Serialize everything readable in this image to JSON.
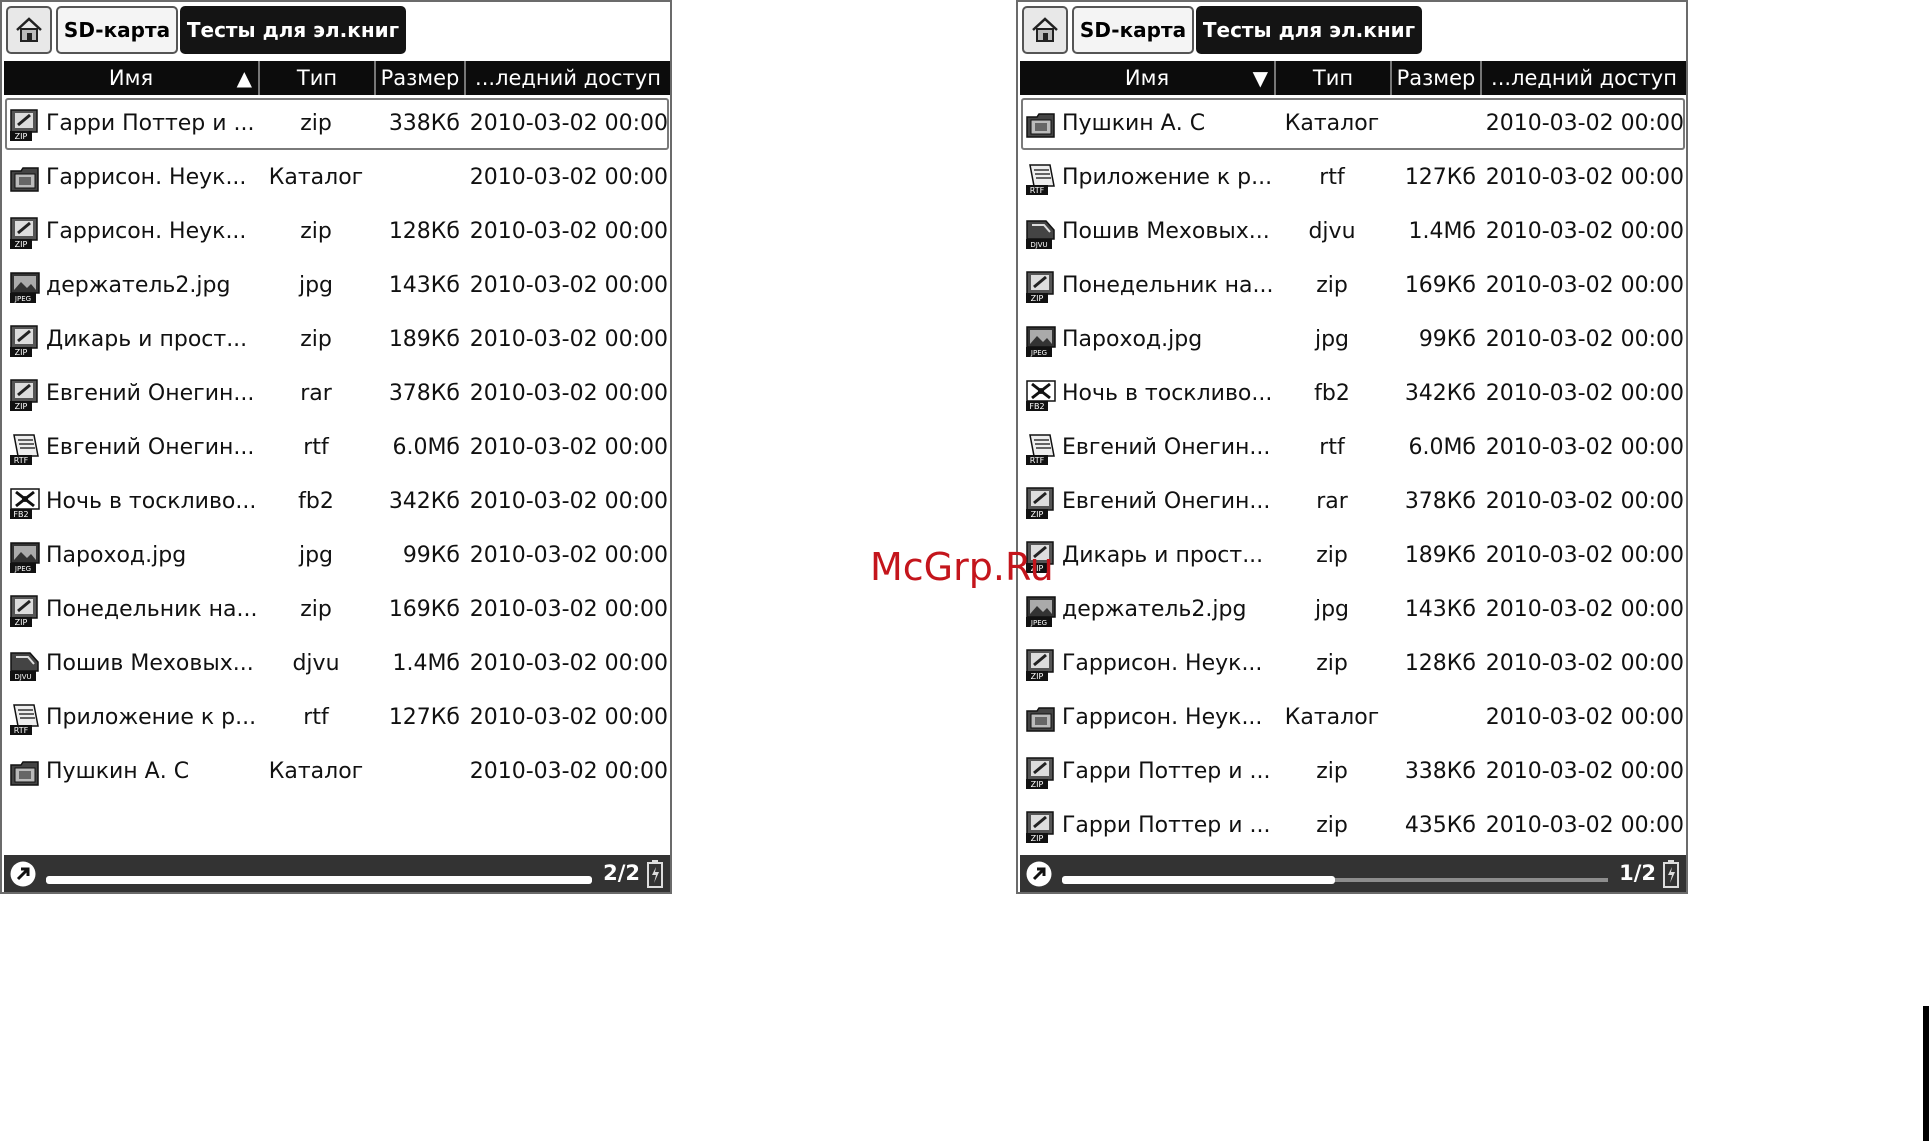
{
  "watermark": "McGrp.Ru",
  "panels": [
    {
      "breadcrumb": {
        "home_icon": "home-icon",
        "sd_label": "SD-карта",
        "current_label": "Тесты для эл.книг"
      },
      "columns": {
        "name": "Имя",
        "type": "Тип",
        "size": "Размер",
        "date": "...ледний доступ",
        "sort_indicator": "▲"
      },
      "rows": [
        {
          "icon": "zip-icon",
          "name": "Гарри Поттер и ...",
          "type": "zip",
          "size": "338Кб",
          "date": "2010-03-02 00:00",
          "selected": true
        },
        {
          "icon": "folder-icon",
          "name": "Гаррисон. Неук...",
          "type": "Каталог",
          "size": "",
          "date": "2010-03-02 00:00"
        },
        {
          "icon": "zip-icon",
          "name": "Гаррисон. Неук...",
          "type": "zip",
          "size": "128Кб",
          "date": "2010-03-02 00:00"
        },
        {
          "icon": "jpeg-icon",
          "name": "держатель2.jpg",
          "type": "jpg",
          "size": "143Кб",
          "date": "2010-03-02 00:00"
        },
        {
          "icon": "zip-icon",
          "name": "Дикарь и прост...",
          "type": "zip",
          "size": "189Кб",
          "date": "2010-03-02 00:00"
        },
        {
          "icon": "zip-icon",
          "name": "Евгений Онегин...",
          "type": "rar",
          "size": "378Кб",
          "date": "2010-03-02 00:00"
        },
        {
          "icon": "rtf-icon",
          "name": "Евгений Онегин...",
          "type": "rtf",
          "size": "6.0Мб",
          "date": "2010-03-02 00:00"
        },
        {
          "icon": "fb2-icon",
          "name": "Ночь в тоскливо...",
          "type": "fb2",
          "size": "342Кб",
          "date": "2010-03-02 00:00"
        },
        {
          "icon": "jpeg-icon",
          "name": "Пароход.jpg",
          "type": "jpg",
          "size": "99Кб",
          "date": "2010-03-02 00:00"
        },
        {
          "icon": "zip-icon",
          "name": "Понедельник на...",
          "type": "zip",
          "size": "169Кб",
          "date": "2010-03-02 00:00"
        },
        {
          "icon": "djvu-icon",
          "name": "Пошив Меховых...",
          "type": "djvu",
          "size": "1.4Мб",
          "date": "2010-03-02 00:00"
        },
        {
          "icon": "rtf-icon",
          "name": "Приложение к р...",
          "type": "rtf",
          "size": "127Кб",
          "date": "2010-03-02 00:00"
        },
        {
          "icon": "folder-icon",
          "name": "Пушкин А. С",
          "type": "Каталог",
          "size": "",
          "date": "2010-03-02 00:00"
        }
      ],
      "status": {
        "page": "2/2",
        "progress": 1.0
      }
    },
    {
      "breadcrumb": {
        "home_icon": "home-icon",
        "sd_label": "SD-карта",
        "current_label": "Тесты для эл.книг"
      },
      "columns": {
        "name": "Имя",
        "type": "Тип",
        "size": "Размер",
        "date": "...ледний доступ",
        "sort_indicator": "▼"
      },
      "rows": [
        {
          "icon": "folder-icon",
          "name": "Пушкин А. С",
          "type": "Каталог",
          "size": "",
          "date": "2010-03-02 00:00",
          "selected": true
        },
        {
          "icon": "rtf-icon",
          "name": "Приложение к р...",
          "type": "rtf",
          "size": "127Кб",
          "date": "2010-03-02 00:00"
        },
        {
          "icon": "djvu-icon",
          "name": "Пошив Меховых...",
          "type": "djvu",
          "size": "1.4Мб",
          "date": "2010-03-02 00:00"
        },
        {
          "icon": "zip-icon",
          "name": "Понедельник на...",
          "type": "zip",
          "size": "169Кб",
          "date": "2010-03-02 00:00"
        },
        {
          "icon": "jpeg-icon",
          "name": "Пароход.jpg",
          "type": "jpg",
          "size": "99Кб",
          "date": "2010-03-02 00:00"
        },
        {
          "icon": "fb2-icon",
          "name": "Ночь в тоскливо...",
          "type": "fb2",
          "size": "342Кб",
          "date": "2010-03-02 00:00"
        },
        {
          "icon": "rtf-icon",
          "name": "Евгений Онегин...",
          "type": "rtf",
          "size": "6.0Мб",
          "date": "2010-03-02 00:00"
        },
        {
          "icon": "zip-icon",
          "name": "Евгений Онегин...",
          "type": "rar",
          "size": "378Кб",
          "date": "2010-03-02 00:00"
        },
        {
          "icon": "zip-icon",
          "name": "Дикарь и прост...",
          "type": "zip",
          "size": "189Кб",
          "date": "2010-03-02 00:00"
        },
        {
          "icon": "jpeg-icon",
          "name": "держатель2.jpg",
          "type": "jpg",
          "size": "143Кб",
          "date": "2010-03-02 00:00"
        },
        {
          "icon": "zip-icon",
          "name": "Гаррисон. Неук...",
          "type": "zip",
          "size": "128Кб",
          "date": "2010-03-02 00:00"
        },
        {
          "icon": "folder-icon",
          "name": "Гаррисон. Неук...",
          "type": "Каталог",
          "size": "",
          "date": "2010-03-02 00:00"
        },
        {
          "icon": "zip-icon",
          "name": "Гарри Поттер и ...",
          "type": "zip",
          "size": "338Кб",
          "date": "2010-03-02 00:00"
        },
        {
          "icon": "zip-icon",
          "name": "Гарри Поттер и ...",
          "type": "zip",
          "size": "435Кб",
          "date": "2010-03-02 00:00"
        }
      ],
      "status": {
        "page": "1/2",
        "progress": 0.5
      }
    }
  ]
}
